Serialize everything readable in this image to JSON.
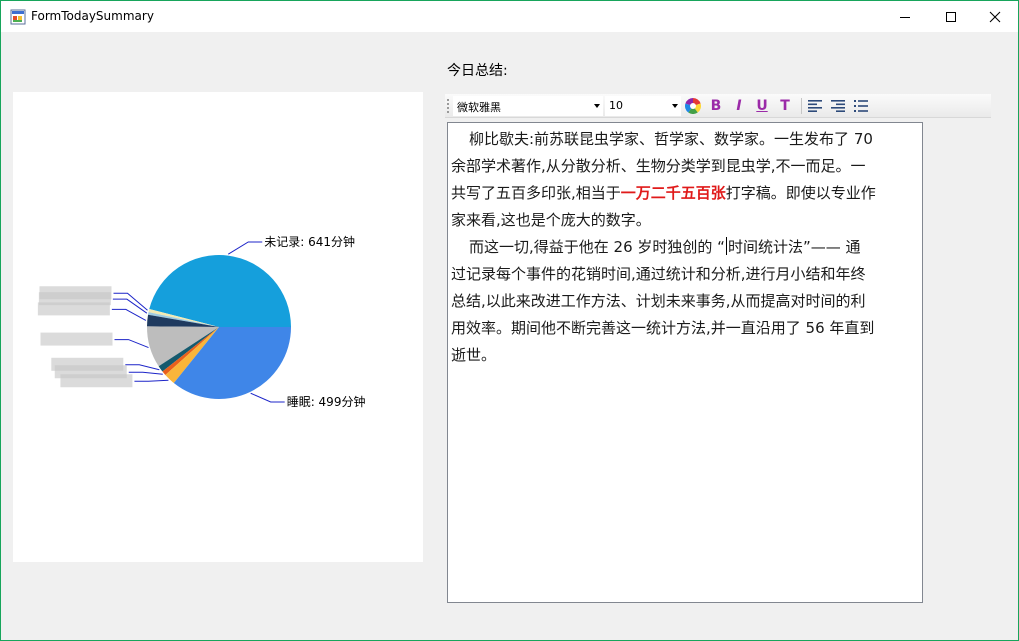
{
  "window": {
    "title": "FormTodaySummary",
    "border_color": "#17a55b"
  },
  "icons": {
    "app": "app-icon",
    "minimize": "minimize-icon",
    "maximize": "maximize-icon",
    "close": "close-icon",
    "color": "color-picker-icon",
    "align_left": "align-left-icon",
    "align_right": "align-right-icon",
    "list": "bullet-list-icon"
  },
  "summary": {
    "label": "今日总结:"
  },
  "toolbar": {
    "font_value": "微软雅黑",
    "size_value": "10",
    "bold_label": "B",
    "italic_label": "I",
    "underline_label": "U",
    "strike_label": "T",
    "accent_color": "#9b2aa8"
  },
  "editor": {
    "p1_line1": "柳比歇夫:前苏联昆虫学家、哲学家、数学家。一生发布了 70",
    "p1_line2": "余部学术著作,从分散分析、生物分类学到昆虫学,不一而足。一",
    "p1_line3_a": "共写了五百多印张,相当于",
    "p1_line3_red": "一万二千五百张",
    "p1_line3_b": "打字稿。即使以专业作",
    "p1_line4": "家来看,这也是个庞大的数字。",
    "p2_line1_a": "而这一切,得益于他在 26 岁时独创的 “",
    "p2_line1_b": "时间统计法”—— 通",
    "p2_line2": "过记录每个事件的花销时间,通过统计和分析,进行月小结和年终",
    "p2_line3": "总结,以此来改进工作方法、计划未来事务,从而提高对时间的利",
    "p2_line4": "用效率。期间他不断完善这一统计方法,并一直沿用了 56 年直到",
    "p2_line5": "逝世。",
    "red_color": "#e01a1a"
  },
  "chart_data": {
    "type": "pie",
    "unit": "分钟",
    "slices": [
      {
        "name": "未记录",
        "value": 641,
        "label": "未记录: 641分钟",
        "color": "#159fdc"
      },
      {
        "name": "",
        "value": 10,
        "label": "",
        "color": "#f2eab4"
      },
      {
        "name": "",
        "value": 8,
        "label": "",
        "color": "#9ecae1"
      },
      {
        "name": "",
        "value": 36,
        "label": "",
        "color": "#1f3a5f"
      },
      {
        "name": "",
        "value": 130,
        "label": "",
        "color": "#bdbdbd"
      },
      {
        "name": "",
        "value": 20,
        "label": "",
        "color": "#155a6e"
      },
      {
        "name": "",
        "value": 14,
        "label": "",
        "color": "#e8601c"
      },
      {
        "name": "",
        "value": 36,
        "label": "",
        "color": "#f9b53a"
      },
      {
        "name": "睡眠",
        "value": 499,
        "label": "睡眠: 499分钟",
        "color": "#3f86e8"
      }
    ]
  }
}
